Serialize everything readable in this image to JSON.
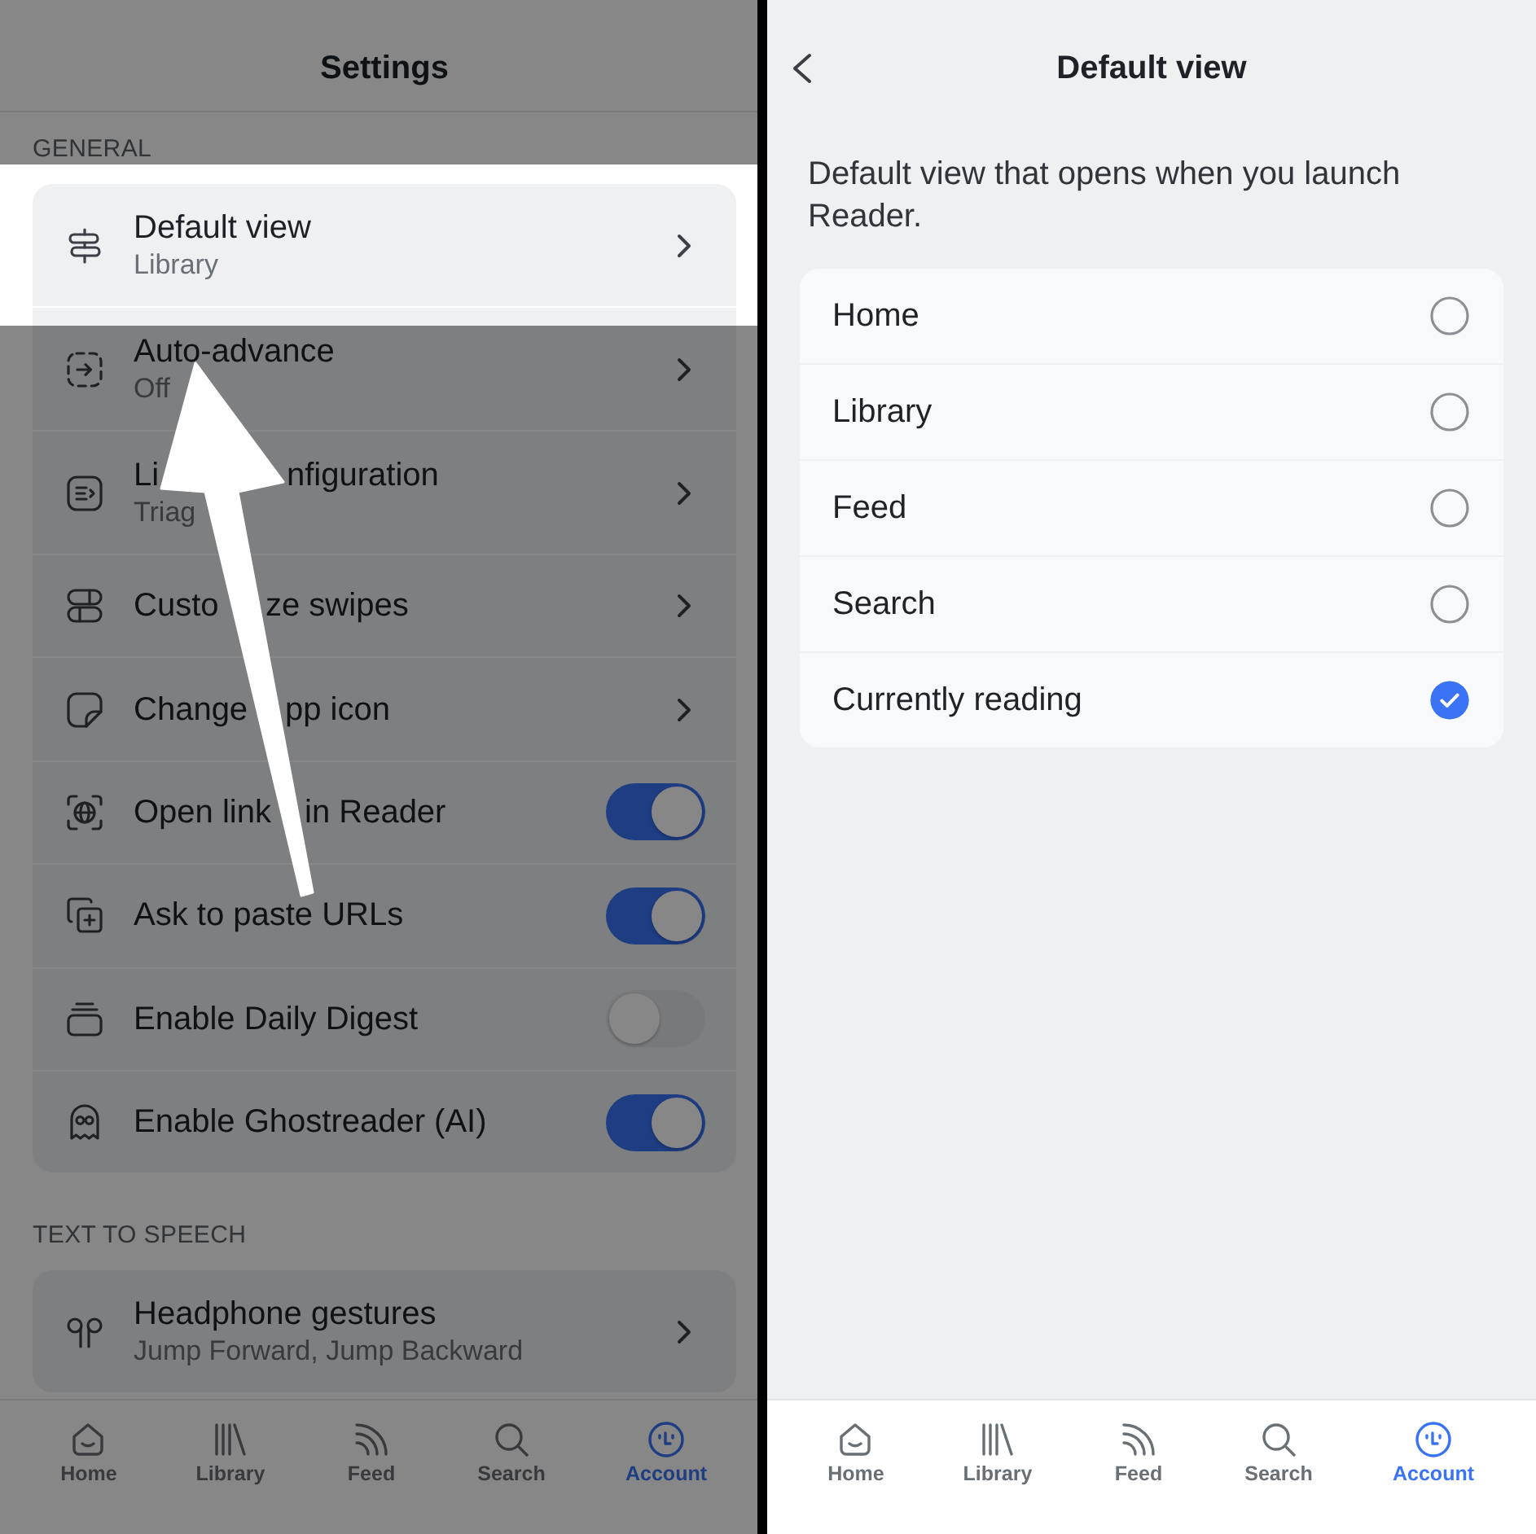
{
  "settings_screen": {
    "title": "Settings",
    "sections": [
      {
        "heading": "GENERAL",
        "items": [
          {
            "kind": "link",
            "label": "Default view",
            "value": "Library",
            "highlighted": true
          },
          {
            "kind": "link",
            "label": "Auto-advance",
            "value": "Off",
            "highlighted": false
          },
          {
            "kind": "link",
            "label_parts": [
              "Li",
              "nfiguration"
            ],
            "value": "Triag",
            "highlighted": false
          },
          {
            "kind": "link",
            "label_parts": [
              "Custo",
              "ze swipes"
            ],
            "highlighted": false
          },
          {
            "kind": "link",
            "label_parts": [
              "Change",
              "pp icon"
            ],
            "highlighted": false
          },
          {
            "kind": "toggle",
            "label_parts": [
              "Open link",
              "in Reader"
            ],
            "on": true,
            "highlighted": false
          },
          {
            "kind": "toggle",
            "label": "Ask to paste URLs",
            "on": true,
            "highlighted": false
          },
          {
            "kind": "toggle",
            "label": "Enable Daily Digest",
            "on": false,
            "highlighted": false
          },
          {
            "kind": "toggle",
            "label": "Enable Ghostreader (AI)",
            "on": true,
            "highlighted": false
          }
        ]
      },
      {
        "heading": "TEXT TO SPEECH",
        "items": [
          {
            "kind": "link",
            "label": "Headphone gestures",
            "value": "Jump Forward, Jump Backward",
            "highlighted": false
          }
        ]
      }
    ],
    "tab_bar": [
      {
        "label": "Home",
        "selected": false
      },
      {
        "label": "Library",
        "selected": false
      },
      {
        "label": "Feed",
        "selected": false
      },
      {
        "label": "Search",
        "selected": false
      },
      {
        "label": "Account",
        "selected": true
      }
    ]
  },
  "default_view_screen": {
    "title": "Default view",
    "description": "Default view that opens when you launch Reader.",
    "options": [
      {
        "label": "Home",
        "selected": false
      },
      {
        "label": "Library",
        "selected": false
      },
      {
        "label": "Feed",
        "selected": false
      },
      {
        "label": "Search",
        "selected": false
      },
      {
        "label": "Currently reading",
        "selected": true
      }
    ],
    "tab_bar": [
      {
        "label": "Home",
        "selected": false
      },
      {
        "label": "Library",
        "selected": false
      },
      {
        "label": "Feed",
        "selected": false
      },
      {
        "label": "Search",
        "selected": false
      },
      {
        "label": "Account",
        "selected": true
      }
    ]
  }
}
